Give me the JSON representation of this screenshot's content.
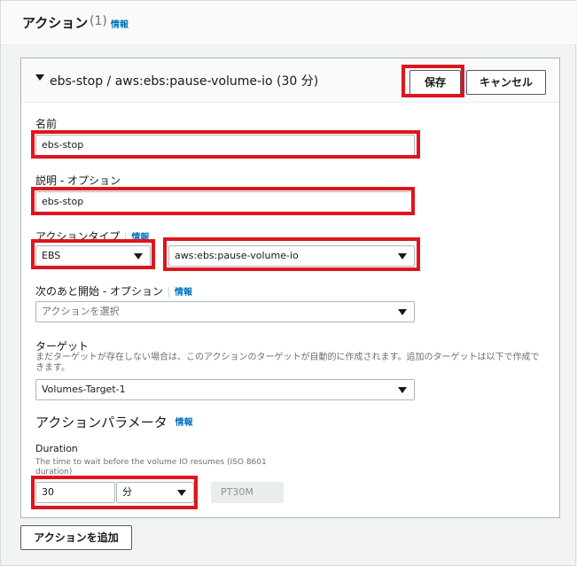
{
  "section": {
    "title": "アクション",
    "count": "(1)",
    "info": "情報"
  },
  "card": {
    "title": "ebs-stop / aws:ebs:pause-volume-io (30 分)",
    "save_label": "保存",
    "cancel_label": "キャンセル"
  },
  "form": {
    "name_label": "名前",
    "name_value": "ebs-stop",
    "description_label": "説明 - オプション",
    "description_value": "ebs-stop",
    "action_type_label": "アクションタイプ",
    "action_type_info": "情報",
    "action_type_service": "EBS",
    "action_type_action": "aws:ebs:pause-volume-io",
    "start_after_label": "次のあと開始 - オプション",
    "start_after_info": "情報",
    "start_after_placeholder": "アクションを選択",
    "target_label": "ターゲット",
    "target_desc": "まだターゲットが存在しない場合は、このアクションのターゲットが自動的に作成されます。追加のターゲットは以下で作成できます。",
    "target_value": "Volumes-Target-1",
    "params_heading": "アクションパラメータ",
    "params_info": "情報",
    "duration_label": "Duration",
    "duration_desc_line1": "The time to wait before the volume IO resumes (ISO 8601",
    "duration_desc_line2": "duration)",
    "duration_value": "30",
    "duration_unit": "分",
    "duration_iso": "PT30M"
  },
  "footer": {
    "add_action_label": "アクションを追加"
  },
  "colors": {
    "highlight": "#e0141e",
    "link": "#0073bb"
  }
}
